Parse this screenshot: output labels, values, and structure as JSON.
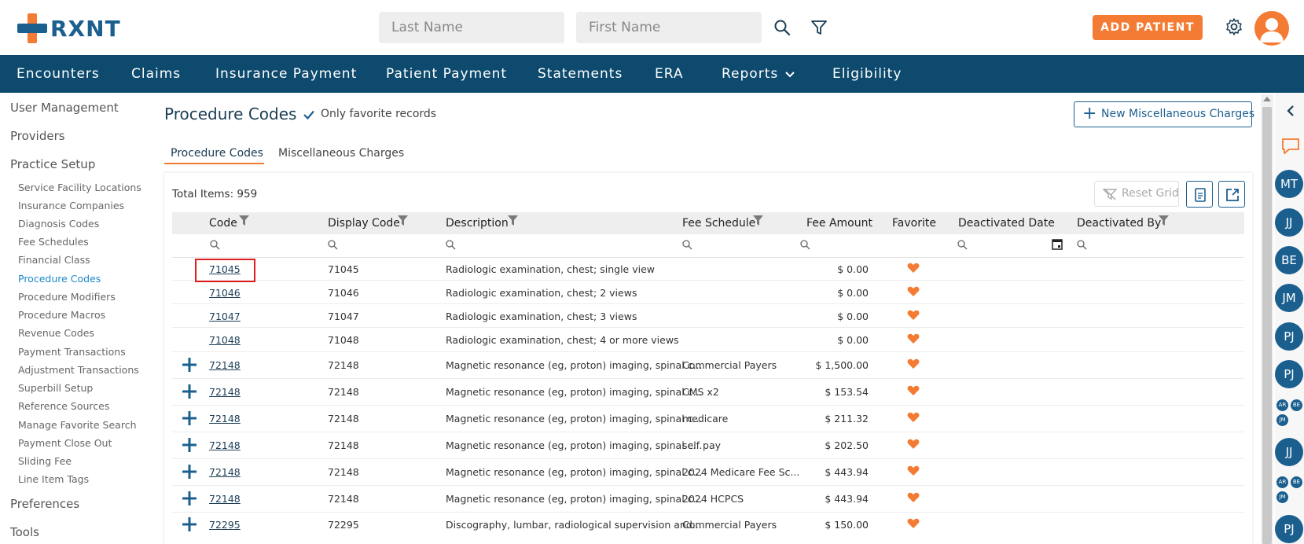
{
  "brand": {
    "name": "RXNT"
  },
  "header": {
    "last_name_placeholder": "Last Name",
    "first_name_placeholder": "First Name",
    "add_patient_label": "ADD PATIENT"
  },
  "nav": {
    "items": [
      "Encounters",
      "Claims",
      "Insurance Payment",
      "Patient Payment",
      "Statements",
      "ERA",
      "Reports",
      "Eligibility"
    ]
  },
  "sidebar": {
    "sections": [
      "User Management",
      "Providers",
      "Practice Setup",
      "Preferences",
      "Tools"
    ],
    "practice_setup_items": [
      "Service Facility Locations",
      "Insurance Companies",
      "Diagnosis Codes",
      "Fee Schedules",
      "Financial Class",
      "Procedure Codes",
      "Procedure Modifiers",
      "Procedure Macros",
      "Revenue Codes",
      "Payment Transactions",
      "Adjustment Transactions",
      "Superbill Setup",
      "Reference Sources",
      "Manage Favorite Search",
      "Payment Close Out",
      "Sliding Fee",
      "Line Item Tags"
    ],
    "active_item": "Procedure Codes"
  },
  "main": {
    "title": "Procedure Codes",
    "only_favorites_label": "Only favorite records",
    "new_misc_label": "New Miscellaneous Charges",
    "tabs": [
      "Procedure Codes",
      "Miscellaneous Charges"
    ],
    "total_items": "Total Items: 959",
    "reset_grid_label": "Reset Grid"
  },
  "grid": {
    "columns": [
      "Code",
      "Display Code",
      "Description",
      "Fee Schedule",
      "Fee Amount",
      "Favorite",
      "Deactivated Date",
      "Deactivated By"
    ],
    "rows": [
      {
        "expand": false,
        "code": "71045",
        "display": "71045",
        "desc": "Radiologic examination, chest; single view",
        "schedule": "",
        "fee": "$ 0.00"
      },
      {
        "expand": false,
        "code": "71046",
        "display": "71046",
        "desc": "Radiologic examination, chest; 2 views",
        "schedule": "",
        "fee": "$ 0.00"
      },
      {
        "expand": false,
        "code": "71047",
        "display": "71047",
        "desc": "Radiologic examination, chest; 3 views",
        "schedule": "",
        "fee": "$ 0.00"
      },
      {
        "expand": false,
        "code": "71048",
        "display": "71048",
        "desc": "Radiologic examination, chest; 4 or more views",
        "schedule": "",
        "fee": "$ 0.00"
      },
      {
        "expand": true,
        "code": "72148",
        "display": "72148",
        "desc": "Magnetic resonance (eg, proton) imaging, spinal c...",
        "schedule": "Commercial Payers",
        "fee": "$ 1,500.00"
      },
      {
        "expand": true,
        "code": "72148",
        "display": "72148",
        "desc": "Magnetic resonance (eg, proton) imaging, spinal c...",
        "schedule": "CMS x2",
        "fee": "$ 153.54"
      },
      {
        "expand": true,
        "code": "72148",
        "display": "72148",
        "desc": "Magnetic resonance (eg, proton) imaging, spinal c...",
        "schedule": "medicare",
        "fee": "$ 211.32"
      },
      {
        "expand": true,
        "code": "72148",
        "display": "72148",
        "desc": "Magnetic resonance (eg, proton) imaging, spinal c...",
        "schedule": "self pay",
        "fee": "$ 202.50"
      },
      {
        "expand": true,
        "code": "72148",
        "display": "72148",
        "desc": "Magnetic resonance (eg, proton) imaging, spinal c...",
        "schedule": "2024 Medicare Fee Sc...",
        "fee": "$ 443.94"
      },
      {
        "expand": true,
        "code": "72148",
        "display": "72148",
        "desc": "Magnetic resonance (eg, proton) imaging, spinal c...",
        "schedule": "2024 HCPCS",
        "fee": "$ 443.94"
      },
      {
        "expand": true,
        "code": "72295",
        "display": "72295",
        "desc": "Discography, lumbar, radiological supervision and...",
        "schedule": "Commercial Payers",
        "fee": "$ 150.00"
      }
    ]
  },
  "rail": {
    "avatars": [
      "MT",
      "JJ",
      "BE",
      "JM",
      "PJ",
      "PJ",
      "JJ",
      "PJ"
    ],
    "mini_group_1": [
      "AR",
      "BE",
      "JM"
    ],
    "mini_group_2": [
      "AR",
      "BE",
      "JM"
    ]
  },
  "colors": {
    "brand_blue": "#1b5f8f",
    "nav_bg": "#0d4a6e",
    "accent_orange": "#f47b33",
    "link_blue": "#1e88c9"
  }
}
